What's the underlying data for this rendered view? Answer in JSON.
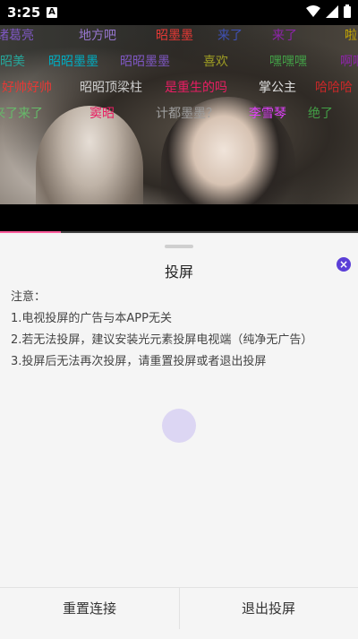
{
  "status_bar": {
    "time": "3:25",
    "notification_glyph": "A",
    "icons": [
      "wifi-icon",
      "signal-icon",
      "battery-icon"
    ]
  },
  "danmaku": [
    {
      "text": "诸葛亮",
      "color": "#7e57c2"
    },
    {
      "text": "地方吧",
      "color": "#9575cd"
    },
    {
      "text": "昭墨墨",
      "color": "#e53935"
    },
    {
      "text": "来了",
      "color": "#3f51b5"
    },
    {
      "text": "来了",
      "color": "#8e24aa"
    },
    {
      "text": "啦",
      "color": "#c6a700"
    },
    {
      "text": "昭美",
      "color": "#26a69a"
    },
    {
      "text": "昭昭墨墨",
      "color": "#00acc1"
    },
    {
      "text": "昭昭墨墨",
      "color": "#7e57c2"
    },
    {
      "text": "喜欢",
      "color": "#9e9d24"
    },
    {
      "text": "嘿嘿嘿",
      "color": "#43a047"
    },
    {
      "text": "啊啊",
      "color": "#8e24aa"
    },
    {
      "text": "好帅好帅",
      "color": "#e53935"
    },
    {
      "text": "昭昭顶梁柱",
      "color": "#cccccc"
    },
    {
      "text": "是重生的吗",
      "color": "#e91e63"
    },
    {
      "text": "掌公主",
      "color": "#e0e0e0"
    },
    {
      "text": "哈哈哈",
      "color": "#c62828"
    },
    {
      "text": "我来了来了",
      "color": "#66bb6a"
    },
    {
      "text": "窦昭",
      "color": "#e91e63"
    },
    {
      "text": "计都墨墨？",
      "color": "#9e9e9e"
    },
    {
      "text": "李雪琴",
      "color": "#e040fb"
    },
    {
      "text": "绝了",
      "color": "#43a047"
    }
  ],
  "sheet": {
    "title": "投屏",
    "notice": [
      "注意：",
      "1.电视投屏的广告与本APP无关",
      "2.若无法投屏，建议安装光元素投屏电视端（纯净无广告）",
      "3.投屏后无法再次投屏，请重置投屏或者退出投屏"
    ],
    "close_glyph": "×",
    "reset_label": "重置连接",
    "exit_label": "退出投屏"
  },
  "colors": {
    "accent": "#5b3fd7",
    "progress": "#ff5c9c",
    "spinner": "#dcd6f3"
  }
}
